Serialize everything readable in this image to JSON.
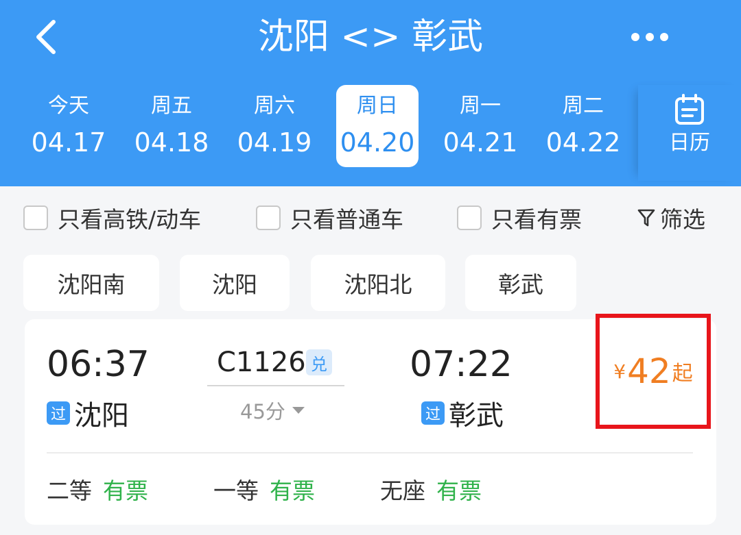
{
  "header": {
    "title": "沈阳 <> 彰武",
    "back_icon": "back-arrow-icon",
    "more_icon": "more-dots-icon"
  },
  "dates": [
    {
      "weekday": "今天",
      "date": "04.17"
    },
    {
      "weekday": "周五",
      "date": "04.18"
    },
    {
      "weekday": "周六",
      "date": "04.19"
    },
    {
      "weekday": "周日",
      "date": "04.20",
      "selected": true
    },
    {
      "weekday": "周一",
      "date": "04.21"
    },
    {
      "weekday": "周二",
      "date": "04.22"
    }
  ],
  "calendar": {
    "label": "日历",
    "icon": "calendar-icon"
  },
  "filters": {
    "high_speed": "只看高铁/动车",
    "regular": "只看普通车",
    "available": "只看有票",
    "filter_label": "筛选",
    "filter_icon": "funnel-icon"
  },
  "stations": [
    "沈阳南",
    "沈阳",
    "沈阳北",
    "彰武"
  ],
  "train": {
    "depart_time": "06:37",
    "depart_station": "沈阳",
    "depart_badge": "过",
    "train_no": "C1126",
    "redeem_badge": "兑",
    "duration": "45分",
    "arrive_time": "07:22",
    "arrive_station": "彰武",
    "arrive_badge": "过",
    "price_currency": "¥",
    "price": "42",
    "price_suffix": "起",
    "seats": [
      {
        "class": "二等",
        "status": "有票"
      },
      {
        "class": "一等",
        "status": "有票"
      },
      {
        "class": "无座",
        "status": "有票"
      }
    ]
  },
  "colors": {
    "header_bg": "#3c9af5",
    "price": "#f07e22",
    "available": "#2fb24a",
    "highlight_box": "#e8151b"
  }
}
